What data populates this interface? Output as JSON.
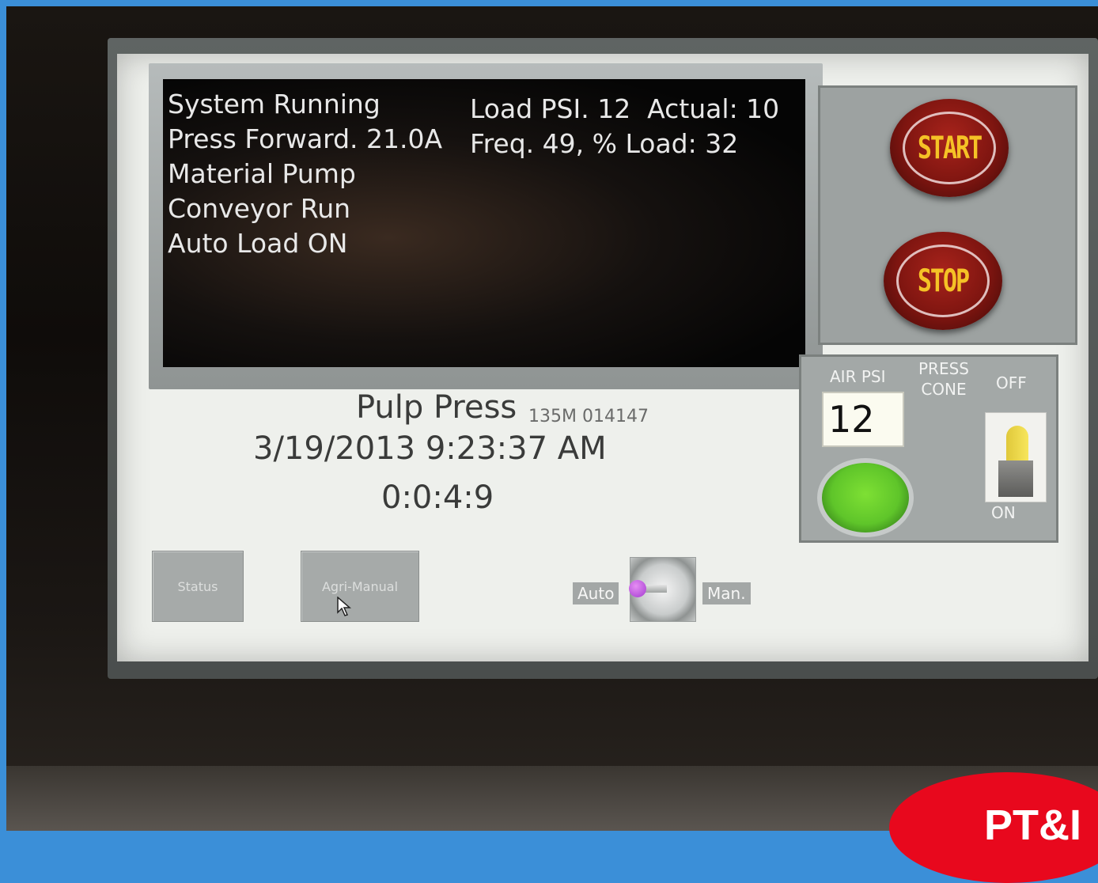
{
  "status_messages": {
    "left": [
      "System Running",
      "Press Forward. 21.0A",
      "Material Pump",
      "Conveyor Run",
      "Auto Load ON"
    ],
    "right": [
      "Load PSI. 12  Actual: 10",
      "Freq. 49, % Load: 32"
    ]
  },
  "controls": {
    "start_label": "START",
    "stop_label": "STOP"
  },
  "air": {
    "air_psi_label": "AIR PSI",
    "air_psi_value": "12",
    "press_cone_label_line1": "PRESS",
    "press_cone_label_line2": "CONE",
    "off_label": "OFF",
    "on_label": "ON"
  },
  "info": {
    "title": "Pulp Press",
    "serial": "135M 014147",
    "datetime": "3/19/2013 9:23:37 AM",
    "elapsed": "0:0:4:9"
  },
  "buttons": {
    "status": "Status",
    "agri_manual": "Agri-Manual"
  },
  "mode": {
    "auto_label": "Auto",
    "manual_label": "Man."
  },
  "logo": {
    "text": "PT&I"
  }
}
